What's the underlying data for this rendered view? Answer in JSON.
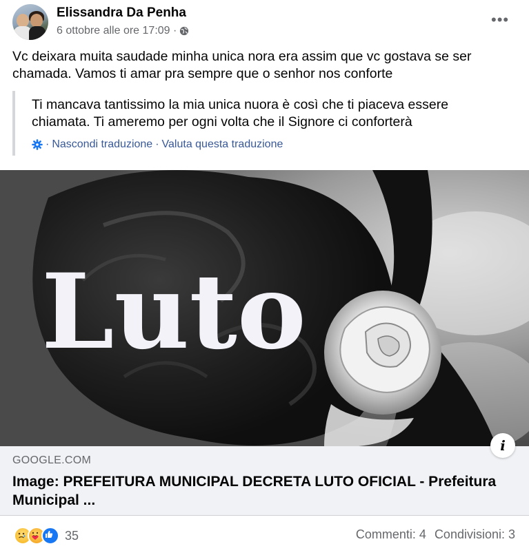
{
  "post": {
    "author_name": "Elissandra Da Penha",
    "timestamp": "6 ottobre alle ore 17:09 ·",
    "privacy_icon": "globe-icon",
    "more_icon": "more-options-icon",
    "more_label": "•••",
    "text": "Vc deixara muita saudade minha unica nora era assim que vc gostava se ser chamada. Vamos ti amar pra sempre que o senhor nos conforte"
  },
  "translation": {
    "text": "Ti mancava tantissimo la mia unica nuora è così che ti piaceva essere chiamata. Ti ameremo per ogni volta che il Signore ci conforterà",
    "hide_label": "Nascondi traduzione",
    "rate_label": "Valuta questa traduzione",
    "separator": "·"
  },
  "image": {
    "overlay_text": "Luto"
  },
  "link_preview": {
    "domain": "GOOGLE.COM",
    "title": "Image: PREFEITURA MUNICIPAL DECRETA LUTO OFICIAL - Prefeitura Municipal ...",
    "info_label": "i"
  },
  "footer": {
    "reaction_icons": [
      "sad-reaction-icon",
      "care-reaction-icon",
      "like-reaction-icon"
    ],
    "reaction_count": "35",
    "comments": "Commenti: 4",
    "shares": "Condivisioni: 3"
  },
  "colors": {
    "link": "#385898",
    "secondary_text": "#65676b",
    "preview_bg": "#f0f2f5",
    "like_blue": "#1877f2"
  }
}
